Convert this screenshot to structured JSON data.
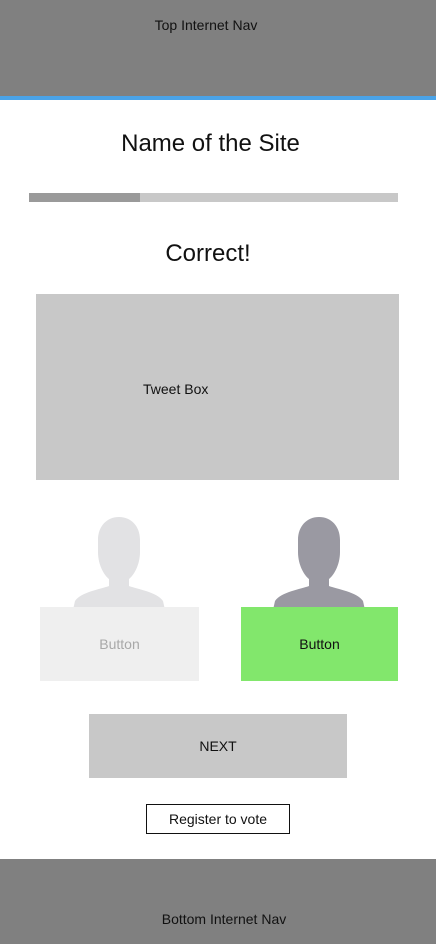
{
  "top_nav": {
    "label": "Top Internet Nav"
  },
  "header": {
    "site_title": "Name of the Site"
  },
  "progress": {
    "fraction": 0.3
  },
  "result": {
    "text": "Correct!"
  },
  "tweet_box": {
    "label": "Tweet Box"
  },
  "choices": [
    {
      "label": "Button",
      "state": "dimmed",
      "avatar_color": "#e2e2e4"
    },
    {
      "label": "Button",
      "state": "selected",
      "avatar_color": "#9a99a2",
      "button_color": "#82e76c"
    }
  ],
  "next_button": {
    "label": "NEXT"
  },
  "register_button": {
    "label": "Register to vote"
  },
  "bottom_nav": {
    "label": "Bottom Internet Nav"
  },
  "colors": {
    "nav": "#808080",
    "accent": "#4aa3e8",
    "placeholder": "#c8c8c8",
    "correct": "#82e76c"
  }
}
